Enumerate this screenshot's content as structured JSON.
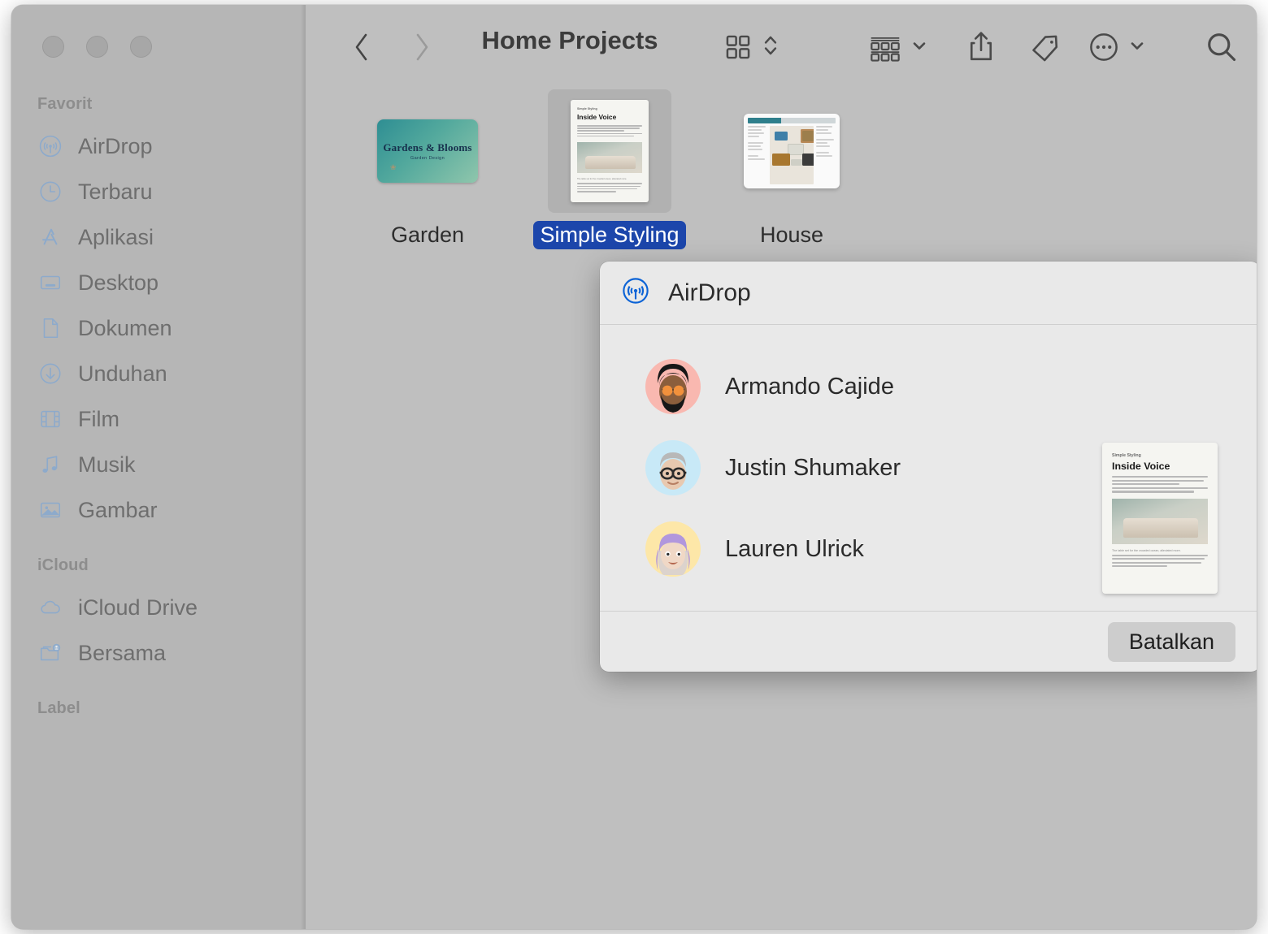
{
  "window": {
    "title": "Home Projects",
    "traffic_lights": [
      "close",
      "minimize",
      "zoom"
    ]
  },
  "toolbar": {
    "back_label": "Back",
    "forward_label": "Forward",
    "icon_view_label": "Icon View",
    "sort_label": "Sort",
    "group_label": "Group",
    "share_label": "Share",
    "tag_label": "Tags",
    "more_label": "More",
    "search_label": "Search"
  },
  "sidebar": {
    "sections": [
      {
        "header": "Favorit"
      },
      {
        "header": "iCloud"
      },
      {
        "header": "Label"
      }
    ],
    "favorites": [
      {
        "label": "AirDrop",
        "icon": "airdrop-icon"
      },
      {
        "label": "Terbaru",
        "icon": "clock-icon"
      },
      {
        "label": "Aplikasi",
        "icon": "appstore-icon"
      },
      {
        "label": "Desktop",
        "icon": "desktop-icon"
      },
      {
        "label": "Dokumen",
        "icon": "document-icon"
      },
      {
        "label": "Unduhan",
        "icon": "download-icon"
      },
      {
        "label": "Film",
        "icon": "film-icon"
      },
      {
        "label": "Musik",
        "icon": "music-note-icon"
      },
      {
        "label": "Gambar",
        "icon": "picture-icon"
      }
    ],
    "icloud": [
      {
        "label": "iCloud Drive",
        "icon": "cloud-icon"
      },
      {
        "label": "Bersama",
        "icon": "shared-folder-icon"
      }
    ]
  },
  "files": [
    {
      "name": "Garden",
      "selected": false,
      "thumb_kind": "card",
      "card_title": "Gardens & Blooms",
      "card_subtitle": "Garden Design"
    },
    {
      "name": "Simple Styling",
      "selected": true,
      "thumb_kind": "document",
      "doc_kicker": "Simple Styling",
      "doc_title": "Inside Voice",
      "doc_caption": "The table set for the crowded ocean, alleviated more."
    },
    {
      "name": "House",
      "selected": false,
      "thumb_kind": "layout"
    }
  ],
  "dialog": {
    "title": "AirDrop",
    "icon": "airdrop-icon",
    "contacts": [
      {
        "name": "Armando Cajide",
        "avatar_bg": "#f9b8b0",
        "avatar": "memoji-armando"
      },
      {
        "name": "Justin Shumaker",
        "avatar_bg": "#c8e9f7",
        "avatar": "memoji-justin"
      },
      {
        "name": "Lauren Ulrick",
        "avatar_bg": "#fde7a8",
        "avatar": "memoji-lauren"
      }
    ],
    "preview": {
      "kicker": "Simple Styling",
      "title": "Inside Voice",
      "caption": "The table set for the crowded ocean, alleviated more."
    },
    "cancel_label": "Batalkan"
  },
  "colors": {
    "selection_blue": "#1c46ab",
    "sidebar_icon_blue": "#7ea6d4",
    "accent_blue": "#0b63d6",
    "window_bg": "#bfbfbf",
    "sidebar_bg": "#b6b6b6",
    "dialog_bg": "#e9e9e9"
  }
}
